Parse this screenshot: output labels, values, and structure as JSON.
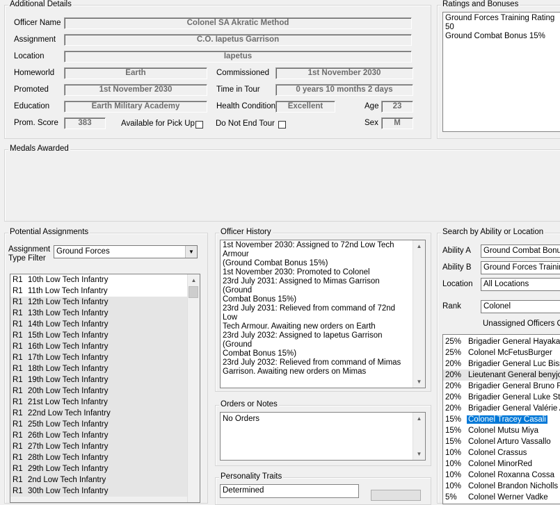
{
  "additional": {
    "legend": "Additional Details",
    "officer_name_label": "Officer Name",
    "officer_name": "Colonel SA Akratic Method",
    "assignment_label": "Assignment",
    "assignment": "C.O. Iapetus Garrison",
    "location_label": "Location",
    "location": "Iapetus",
    "homeworld_label": "Homeworld",
    "homeworld": "Earth",
    "commissioned_label": "Commissioned",
    "commissioned": "1st November 2030",
    "promoted_label": "Promoted",
    "promoted": "1st November 2030",
    "time_in_tour_label": "Time in Tour",
    "time_in_tour": "0 years 10 months 2 days",
    "education_label": "Education",
    "education": "Earth Military Academy",
    "health_label": "Health Condition",
    "health": "Excellent",
    "age_label": "Age",
    "age": "23",
    "prom_score_label": "Prom. Score",
    "prom_score": "383",
    "pickup_label": "Available for Pick Up",
    "not_end_tour_label": "Do Not End Tour",
    "sex_label": "Sex",
    "sex": "M"
  },
  "ratings": {
    "legend": "Ratings and Bonuses",
    "lines": [
      "Ground Forces Training Rating 50",
      "Ground Combat Bonus 15%"
    ]
  },
  "medals": {
    "legend": "Medals Awarded"
  },
  "potential": {
    "legend": "Potential Assignments",
    "filter_label_1": "Assignment",
    "filter_label_2": "Type Filter",
    "filter_value": "Ground Forces",
    "items": [
      {
        "code": "R1",
        "name": "10th Low Tech Infantry"
      },
      {
        "code": "R1",
        "name": "11th Low Tech Infantry"
      },
      {
        "code": "R1",
        "name": "12th Low Tech Infantry"
      },
      {
        "code": "R1",
        "name": "13th Low Tech Infantry"
      },
      {
        "code": "R1",
        "name": "14th Low Tech Infantry"
      },
      {
        "code": "R1",
        "name": "15th Low Tech Infantry"
      },
      {
        "code": "R1",
        "name": "16th Low Tech Infantry"
      },
      {
        "code": "R1",
        "name": "17th Low Tech Infantry"
      },
      {
        "code": "R1",
        "name": "18th Low Tech Infantry"
      },
      {
        "code": "R1",
        "name": "19th Low Tech Infantry"
      },
      {
        "code": "R1",
        "name": "20th Low Tech Infantry"
      },
      {
        "code": "R1",
        "name": "21st Low Tech Infantry"
      },
      {
        "code": "R1",
        "name": "22nd Low Tech Infantry"
      },
      {
        "code": "R1",
        "name": "25th Low Tech Infantry"
      },
      {
        "code": "R1",
        "name": "26th Low Tech Infantry"
      },
      {
        "code": "R1",
        "name": "27th Low Tech Infantry"
      },
      {
        "code": "R1",
        "name": "28th Low Tech Infantry"
      },
      {
        "code": "R1",
        "name": "29th Low Tech Infantry"
      },
      {
        "code": "R1",
        "name": "2nd Low Tech Infantry"
      },
      {
        "code": "R1",
        "name": "30th Low Tech Infantry"
      }
    ]
  },
  "history": {
    "legend": "Officer History",
    "lines": [
      "1st November 2030: Assigned to 72nd Low Tech Armour",
      "(Ground Combat Bonus 15%)",
      "1st November 2030: Promoted to Colonel",
      "23rd July 2031: Assigned to Mimas Garrison (Ground",
      "Combat Bonus 15%)",
      "23rd July 2031: Relieved from command of 72nd Low",
      "Tech Armour. Awaiting new orders on Earth",
      "23rd July 2032: Assigned to Iapetus Garrison (Ground",
      "Combat Bonus 15%)",
      "23rd July 2032: Relieved from command of Mimas",
      "Garrison. Awaiting new orders on Mimas"
    ]
  },
  "orders": {
    "legend": "Orders or Notes",
    "text": "No Orders"
  },
  "personality": {
    "legend": "Personality Traits",
    "first": "Determined"
  },
  "search": {
    "legend": "Search by Ability or Location",
    "ability_a_label": "Ability A",
    "ability_a": "Ground Combat Bonus",
    "ability_b_label": "Ability B",
    "ability_b": "Ground Forces Training",
    "location_label": "Location",
    "location": "All Locations",
    "rank_label": "Rank",
    "rank": "Colonel",
    "unassigned_label": "Unassigned Officers On",
    "officers": [
      {
        "pct": "25%",
        "name": "Brigadier General Hayakawa"
      },
      {
        "pct": "25%",
        "name": "Colonel McFetusBurger"
      },
      {
        "pct": "20%",
        "name": "Brigadier General Luc Bisson"
      },
      {
        "pct": "20%",
        "name": "Lieutenant General benyjon"
      },
      {
        "pct": "20%",
        "name": "Brigadier General Bruno Ro"
      },
      {
        "pct": "20%",
        "name": "Brigadier General Luke Step"
      },
      {
        "pct": "20%",
        "name": "Brigadier General Valérie Au"
      },
      {
        "pct": "15%",
        "name": "Colonel Tracey Casali"
      },
      {
        "pct": "15%",
        "name": "Colonel Mutsu Miya"
      },
      {
        "pct": "15%",
        "name": "Colonel Arturo Vassallo"
      },
      {
        "pct": "10%",
        "name": "Colonel Crassus"
      },
      {
        "pct": "10%",
        "name": "Colonel MinorRed"
      },
      {
        "pct": "10%",
        "name": "Colonel Roxanna Cossa"
      },
      {
        "pct": "10%",
        "name": "Colonel Brandon Nicholls"
      },
      {
        "pct": "5%",
        "name": "Colonel Werner Vadke"
      }
    ]
  }
}
